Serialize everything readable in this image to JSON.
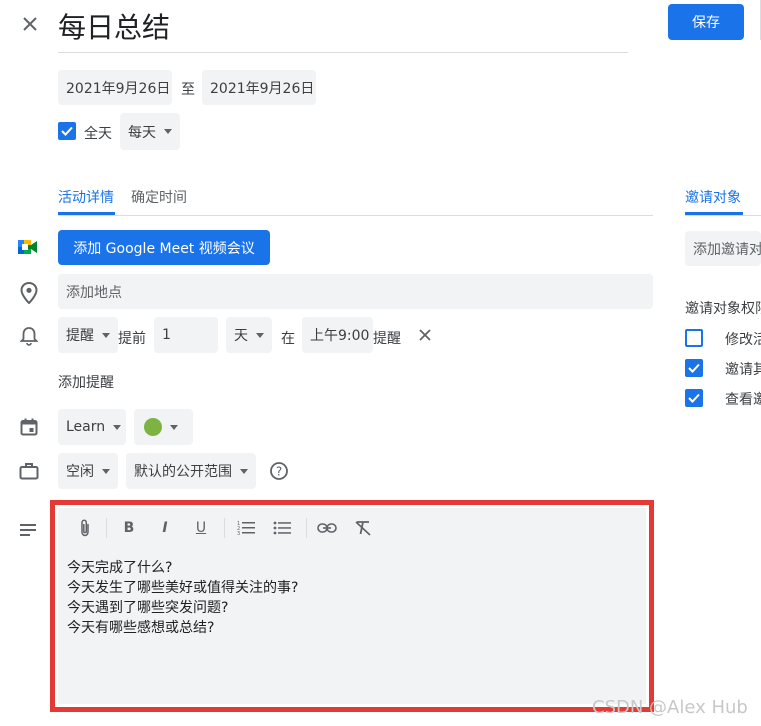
{
  "header": {
    "title": "每日总结",
    "save_label": "保存"
  },
  "dates": {
    "start": "2021年9月26日",
    "separator": "至",
    "end": "2021年9月26日"
  },
  "allday": {
    "label": "全天",
    "checked": true,
    "repeat": "每天"
  },
  "tabs": [
    {
      "label": "活动详情",
      "active": true
    },
    {
      "label": "确定时间",
      "active": false
    }
  ],
  "right_tab": "邀请对象",
  "meet": {
    "label": "添加 Google Meet 视频会议"
  },
  "location": {
    "placeholder": "添加地点"
  },
  "reminder": {
    "type": "提醒",
    "before_label": "提前",
    "amount": "1",
    "unit": "天",
    "at_label": "在",
    "time": "上午9:00",
    "suffix": "提醒"
  },
  "add_reminder": "添加提醒",
  "calendar": {
    "name": "Learn",
    "color": "#7cb342"
  },
  "availability": {
    "status": "空闲",
    "visibility": "默认的公开范围"
  },
  "guests": {
    "add_placeholder": "添加邀请对",
    "permissions_title": "邀请对象权限",
    "permissions": [
      {
        "label": "修改活",
        "checked": false
      },
      {
        "label": "邀请其",
        "checked": true
      },
      {
        "label": "查看邀",
        "checked": true
      }
    ]
  },
  "description_lines": [
    "今天完成了什么?",
    "今天发生了哪些美好或值得关注的事?",
    "今天遇到了哪些突发问题?",
    "今天有哪些感想或总结?"
  ],
  "toolbar": [
    "attach-icon",
    "bold-icon",
    "italic-icon",
    "underline-icon",
    "numbered-list-icon",
    "bulleted-list-icon",
    "link-icon",
    "clear-format-icon"
  ],
  "watermark": "CSDN @Alex Hub",
  "colors": {
    "accent": "#1a73e8",
    "highlight_frame": "#e53935"
  }
}
